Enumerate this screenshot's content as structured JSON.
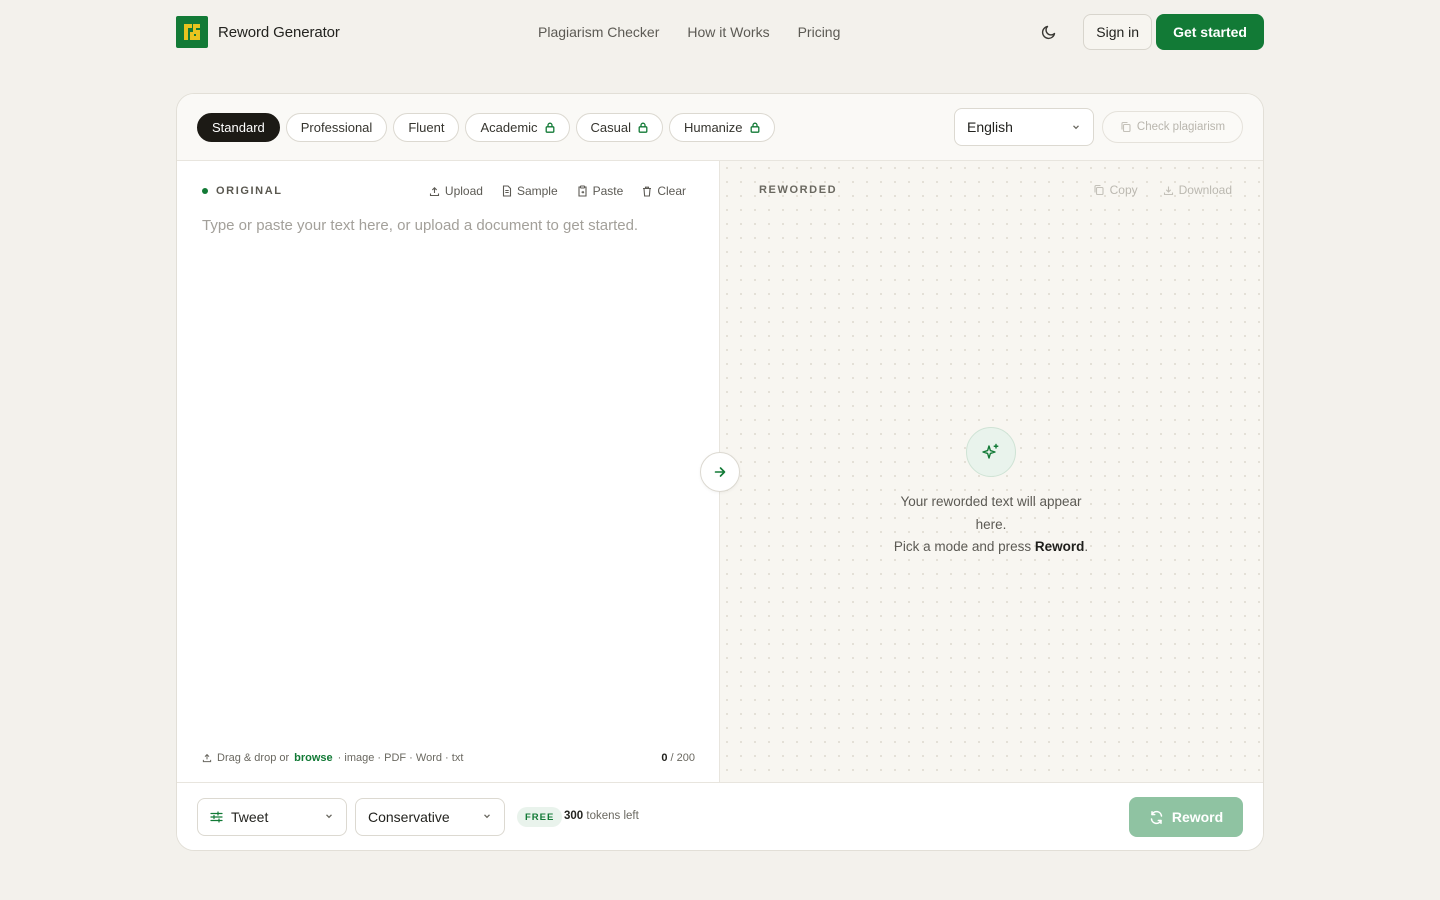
{
  "brand": {
    "name": "Reword Generator"
  },
  "nav": [
    "Plagiarism Checker",
    "How it Works",
    "Pricing"
  ],
  "header": {
    "signin": "Sign in",
    "get_started": "Get started"
  },
  "modes": [
    {
      "label": "Standard",
      "active": true,
      "locked": false
    },
    {
      "label": "Professional",
      "active": false,
      "locked": false
    },
    {
      "label": "Fluent",
      "active": false,
      "locked": false
    },
    {
      "label": "Academic",
      "active": false,
      "locked": true
    },
    {
      "label": "Casual",
      "active": false,
      "locked": true
    },
    {
      "label": "Humanize",
      "active": false,
      "locked": true
    }
  ],
  "language": {
    "selected": "English"
  },
  "check_plagiarism": "Check plagiarism",
  "original": {
    "label": "ORIGINAL",
    "actions": {
      "upload": "Upload",
      "sample": "Sample",
      "paste": "Paste",
      "clear": "Clear"
    },
    "placeholder": "Type or paste your text here, or upload a document to get started.",
    "dropzone": {
      "prefix": "Drag & drop or",
      "browse": "browse",
      "formats": "· image · PDF · Word · txt"
    },
    "count": {
      "current": "0",
      "max": "/ 200"
    }
  },
  "reworded": {
    "label": "REWORDED",
    "actions": {
      "copy": "Copy",
      "download": "Download"
    },
    "empty": {
      "line1": "Your reworded text will appear here.",
      "line2_prefix": "Pick a mode and press",
      "line2_bold": "Reword",
      "line2_suffix": "."
    }
  },
  "bottom": {
    "format": "Tweet",
    "strength": "Conservative",
    "plan": "FREE",
    "tokens_count": "300",
    "tokens_label": "tokens left",
    "reword": "Reword"
  },
  "colors": {
    "brand": "#127a36",
    "logo_accent": "#e8c41f",
    "reword_disabled": "#8fc3a2"
  },
  "icons": [
    "moon-icon",
    "lock-icon",
    "chevron-down-icon",
    "copy-icon",
    "upload-icon",
    "file-icon",
    "clipboard-icon",
    "trash-icon",
    "arrow-right-icon",
    "sparkle-icon",
    "download-icon",
    "sliders-icon",
    "refresh-icon"
  ]
}
